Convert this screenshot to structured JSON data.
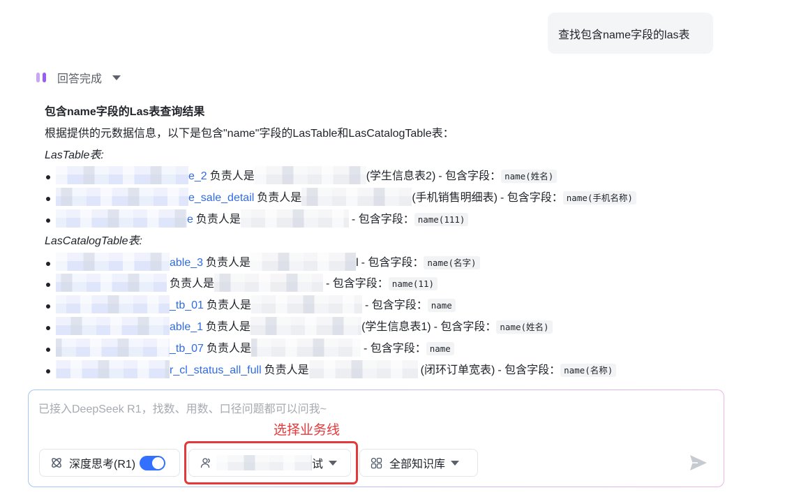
{
  "theme": {
    "accent": "#3370ff",
    "link": "#2f6be6",
    "annotation": "#e5383b",
    "status_icon": "#9b5cf0"
  },
  "user_message": {
    "text": "查找包含name字段的las表"
  },
  "status": {
    "label": "回答完成",
    "icon": "thinking-bars-icon",
    "caret_icon": "caret-down-icon"
  },
  "answer": {
    "heading": "包含name字段的Las表查询结果",
    "intro": "根据提供的元数据信息，以下是包含\"name\"字段的LasTable和LasCatalogTable表：",
    "las_table": {
      "title": "LasTable表:",
      "items": [
        {
          "table": "e_2",
          "owner_label": "负责人是",
          "description": "(学生信息表2)",
          "fields_label": "- 包含字段：",
          "field": "name(姓名)"
        },
        {
          "table": "e_sale_detail",
          "owner_label": "负责人是",
          "description": "(手机销售明细表)",
          "fields_label": "- 包含字段：",
          "field": "name(手机名称)"
        },
        {
          "table": "e",
          "owner_label": "负责人是",
          "fields_label": "- 包含字段：",
          "field": "name(111)"
        }
      ]
    },
    "las_catalog_table": {
      "title": "LasCatalogTable表:",
      "items": [
        {
          "table": "able_3",
          "owner_label": "负责人是",
          "owner_tail": "l",
          "fields_label": "- 包含字段：",
          "field": "name(名字)"
        },
        {
          "owner_label": "负责人是",
          "fields_label": "- 包含字段：",
          "field": "name(11)"
        },
        {
          "table": "_tb_01",
          "owner_label": "负责人是",
          "fields_label": "- 包含字段：",
          "field": "name"
        },
        {
          "table": "able_1",
          "owner_label": "负责人是",
          "description": "(学生信息表1)",
          "fields_label": "- 包含字段：",
          "field": "name(姓名)"
        },
        {
          "table": "_tb_07",
          "owner_label": "负责人是",
          "fields_label": "- 包含字段：",
          "field": "name"
        },
        {
          "table": "r_cl_status_all_full",
          "owner_label": "负责人是",
          "description": "(闭环订单宽表)",
          "fields_label": "- 包含字段：",
          "field": "name(名称)"
        }
      ]
    }
  },
  "composer": {
    "placeholder": "已接入DeepSeek R1，找数、用数、口径问题都可以问我~",
    "deep_think": {
      "label": "深度思考(R1)",
      "enabled": true,
      "icon": "atom-icon"
    },
    "business_line": {
      "visible_text": "试",
      "icon": "user-icon",
      "dropdown_icon": "caret-down-icon"
    },
    "knowledge_base": {
      "label": "全部知识库",
      "icon": "grid-icon",
      "dropdown_icon": "caret-down-icon"
    },
    "send": {
      "icon": "send-icon"
    }
  },
  "annotation": {
    "label": "选择业务线"
  }
}
